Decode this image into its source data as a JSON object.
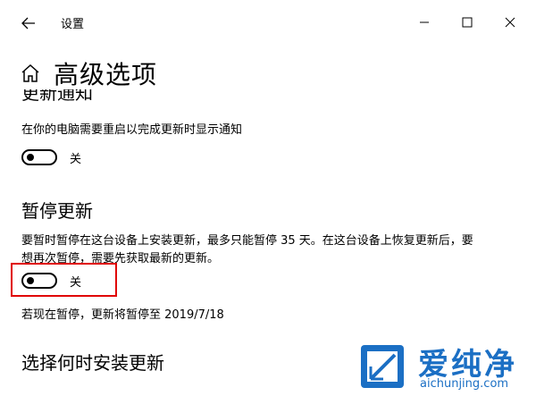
{
  "window": {
    "title": "设置"
  },
  "header": {
    "page_title": "高级选项"
  },
  "sections": {
    "update_notify": {
      "heading": "更新通知",
      "description": "在你的电脑需要重启以完成更新时显示通知",
      "toggle_state": "关"
    },
    "pause_updates": {
      "heading": "暂停更新",
      "description_line1": "要暂时暂停在这台设备上安装更新，最多只能暂停 35 天。在这台设备上恢复更新后，要",
      "description_line2": "想再次暂停，需要先获取最新的更新。",
      "toggle_state": "关",
      "pause_until": "若现在暂停，更新将暂停至 2019/7/18"
    },
    "choose_when": {
      "heading": "选择何时安装更新"
    }
  },
  "watermark": {
    "brand_text": "爱纯净",
    "url": "aichunjing.com"
  },
  "colors": {
    "highlight": "#e00000",
    "watermark_blue": "#1b6fc4"
  }
}
